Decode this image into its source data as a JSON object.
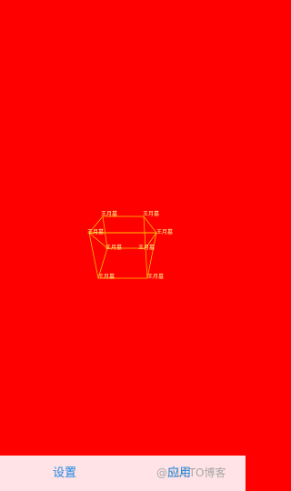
{
  "canvas": {
    "background": "#ff0000",
    "line_color": "#ffd000",
    "label_color": "#ffff99",
    "node_label": "王月墓"
  },
  "bottom_bar": {
    "background": "#ffe3e6",
    "settings_label": "设置",
    "apply_label": "应用",
    "watermark": "@51CTO博客"
  }
}
